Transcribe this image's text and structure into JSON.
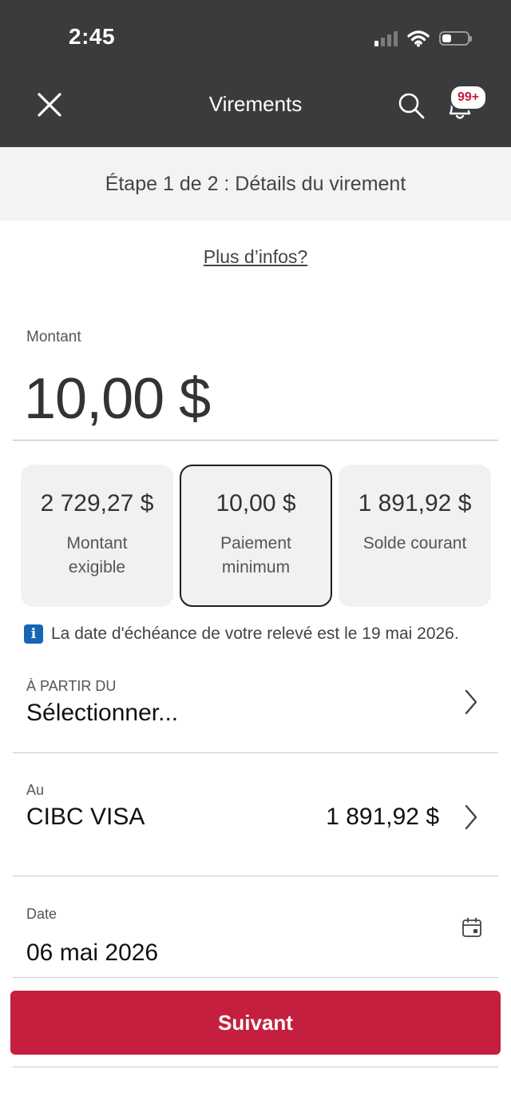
{
  "status_bar": {
    "time": "2:45",
    "signal_bars": 4,
    "signal_active_bars": 1,
    "battery_level_fraction": 0.35,
    "icons": [
      "signal-icon",
      "wifi-icon",
      "battery-icon"
    ]
  },
  "nav": {
    "title": "Virements",
    "notifications_badge": "99+",
    "icons": [
      "close-icon",
      "search-icon",
      "bell-icon"
    ]
  },
  "step": {
    "text": "Étape 1 de 2 : Détails du virement"
  },
  "more_info": {
    "label": "Plus d’infos?"
  },
  "amount": {
    "label": "Montant",
    "value": "10,00 $"
  },
  "quick_amounts": [
    {
      "amount": "2 729,27 $",
      "label": "Montant exigible",
      "selected": false
    },
    {
      "amount": "10,00 $",
      "label": "Paiement minimum",
      "selected": true
    },
    {
      "amount": "1 891,92 $",
      "label": "Solde courant",
      "selected": false
    }
  ],
  "due_notice": {
    "text": "La date d'échéance de votre relevé est le 19 mai 2026."
  },
  "from_account": {
    "label": "À PARTIR DU",
    "value": "Sélectionner..."
  },
  "to_account": {
    "label": "Au",
    "value": "CIBC VISA",
    "balance": "1 891,92 $"
  },
  "date": {
    "label": "Date",
    "value": "06 mai 2026",
    "icon": "calendar-icon"
  },
  "submit": {
    "label": "Suivant"
  },
  "colors": {
    "header_bg": "#3a3b3d",
    "primary": "#c41f3e",
    "info_blue": "#1766b4",
    "card_bg": "#f1f1f1"
  }
}
